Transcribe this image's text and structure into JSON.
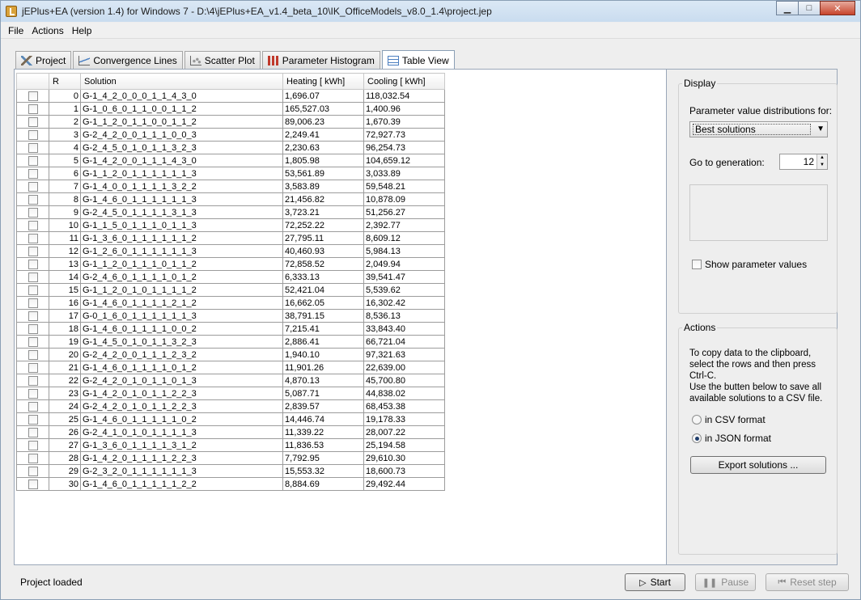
{
  "window": {
    "title": "jEPlus+EA (version 1.4) for Windows 7 - D:\\4\\jEPlus+EA_v1.4_beta_10\\IK_OfficeModels_v8.0_1.4\\project.jep",
    "controls": {
      "minimize": "▁",
      "maximize": "□",
      "close": "✕"
    }
  },
  "menu": {
    "items": [
      "File",
      "Actions",
      "Help"
    ]
  },
  "tabs": [
    {
      "label": "Project",
      "icon": "project-icon"
    },
    {
      "label": "Convergence Lines",
      "icon": "convergence-lines-icon"
    },
    {
      "label": "Scatter Plot",
      "icon": "scatter-plot-icon"
    },
    {
      "label": "Parameter Histogram",
      "icon": "histogram-icon"
    },
    {
      "label": "Table View",
      "icon": "table-icon",
      "active": true
    }
  ],
  "table": {
    "columns": [
      "",
      "R",
      "Solution",
      "Heating [ kWh]",
      "Cooling [ kWh]"
    ],
    "rows": [
      {
        "r": "0",
        "solution": "G-1_4_2_0_0_0_1_1_4_3_0",
        "heating": "1,696.07",
        "cooling": "118,032.54"
      },
      {
        "r": "1",
        "solution": "G-1_0_6_0_1_1_0_0_1_1_2",
        "heating": "165,527.03",
        "cooling": "1,400.96"
      },
      {
        "r": "2",
        "solution": "G-1_1_2_0_1_1_0_0_1_1_2",
        "heating": "89,006.23",
        "cooling": "1,670.39"
      },
      {
        "r": "3",
        "solution": "G-2_4_2_0_0_1_1_1_0_0_3",
        "heating": "2,249.41",
        "cooling": "72,927.73"
      },
      {
        "r": "4",
        "solution": "G-2_4_5_0_1_0_1_1_3_2_3",
        "heating": "2,230.63",
        "cooling": "96,254.73"
      },
      {
        "r": "5",
        "solution": "G-1_4_2_0_0_1_1_1_4_3_0",
        "heating": "1,805.98",
        "cooling": "104,659.12"
      },
      {
        "r": "6",
        "solution": "G-1_1_2_0_1_1_1_1_1_1_3",
        "heating": "53,561.89",
        "cooling": "3,033.89"
      },
      {
        "r": "7",
        "solution": "G-1_4_0_0_1_1_1_1_3_2_2",
        "heating": "3,583.89",
        "cooling": "59,548.21"
      },
      {
        "r": "8",
        "solution": "G-1_4_6_0_1_1_1_1_1_1_3",
        "heating": "21,456.82",
        "cooling": "10,878.09"
      },
      {
        "r": "9",
        "solution": "G-2_4_5_0_1_1_1_1_3_1_3",
        "heating": "3,723.21",
        "cooling": "51,256.27"
      },
      {
        "r": "10",
        "solution": "G-1_1_5_0_1_1_1_0_1_1_3",
        "heating": "72,252.22",
        "cooling": "2,392.77"
      },
      {
        "r": "11",
        "solution": "G-1_3_6_0_1_1_1_1_1_1_2",
        "heating": "27,795.11",
        "cooling": "8,609.12"
      },
      {
        "r": "12",
        "solution": "G-1_2_6_0_1_1_1_1_1_1_3",
        "heating": "40,460.93",
        "cooling": "5,984.13"
      },
      {
        "r": "13",
        "solution": "G-1_1_2_0_1_1_1_0_1_1_2",
        "heating": "72,858.52",
        "cooling": "2,049.94"
      },
      {
        "r": "14",
        "solution": "G-2_4_6_0_1_1_1_1_0_1_2",
        "heating": "6,333.13",
        "cooling": "39,541.47"
      },
      {
        "r": "15",
        "solution": "G-1_1_2_0_1_0_1_1_1_1_2",
        "heating": "52,421.04",
        "cooling": "5,539.62"
      },
      {
        "r": "16",
        "solution": "G-1_4_6_0_1_1_1_1_2_1_2",
        "heating": "16,662.05",
        "cooling": "16,302.42"
      },
      {
        "r": "17",
        "solution": "G-0_1_6_0_1_1_1_1_1_1_3",
        "heating": "38,791.15",
        "cooling": "8,536.13"
      },
      {
        "r": "18",
        "solution": "G-1_4_6_0_1_1_1_1_0_0_2",
        "heating": "7,215.41",
        "cooling": "33,843.40"
      },
      {
        "r": "19",
        "solution": "G-1_4_5_0_1_0_1_1_3_2_3",
        "heating": "2,886.41",
        "cooling": "66,721.04"
      },
      {
        "r": "20",
        "solution": "G-2_4_2_0_0_1_1_1_2_3_2",
        "heating": "1,940.10",
        "cooling": "97,321.63"
      },
      {
        "r": "21",
        "solution": "G-1_4_6_0_1_1_1_1_0_1_2",
        "heating": "11,901.26",
        "cooling": "22,639.00"
      },
      {
        "r": "22",
        "solution": "G-2_4_2_0_1_0_1_1_0_1_3",
        "heating": "4,870.13",
        "cooling": "45,700.80"
      },
      {
        "r": "23",
        "solution": "G-1_4_2_0_1_0_1_1_2_2_3",
        "heating": "5,087.71",
        "cooling": "44,838.02"
      },
      {
        "r": "24",
        "solution": "G-2_4_2_0_1_0_1_1_2_2_3",
        "heating": "2,839.57",
        "cooling": "68,453.38"
      },
      {
        "r": "25",
        "solution": "G-1_4_6_0_1_1_1_1_1_0_2",
        "heating": "14,446.74",
        "cooling": "19,178.33"
      },
      {
        "r": "26",
        "solution": "G-2_4_1_0_1_0_1_1_1_1_3",
        "heating": "11,339.22",
        "cooling": "28,007.22"
      },
      {
        "r": "27",
        "solution": "G-1_3_6_0_1_1_1_1_3_1_2",
        "heating": "11,836.53",
        "cooling": "25,194.58"
      },
      {
        "r": "28",
        "solution": "G-1_4_2_0_1_1_1_1_2_2_3",
        "heating": "7,792.95",
        "cooling": "29,610.30"
      },
      {
        "r": "29",
        "solution": "G-2_3_2_0_1_1_1_1_1_1_3",
        "heating": "15,553.32",
        "cooling": "18,600.73"
      },
      {
        "r": "30",
        "solution": "G-1_4_6_0_1_1_1_1_1_2_2",
        "heating": "8,884.69",
        "cooling": "29,492.44"
      }
    ]
  },
  "display": {
    "legend": "Display",
    "dist_label": "Parameter value distributions for:",
    "dist_value": "Best solutions",
    "gen_label": "Go to generation:",
    "gen_value": "12",
    "show_params_label": "Show parameter values"
  },
  "actions": {
    "legend": "Actions",
    "description_lines": [
      "To copy data to the clipboard,",
      "select the rows and then press",
      "Ctrl-C.",
      "Use the butten below to save all",
      "available solutions to a CSV file."
    ],
    "csv_label": "in CSV format",
    "json_label": "in JSON format",
    "selected_format": "json",
    "export_label": "Export solutions ..."
  },
  "status": {
    "text": "Project loaded",
    "start_label": "Start",
    "pause_label": "Pause",
    "reset_label": "Reset step"
  }
}
